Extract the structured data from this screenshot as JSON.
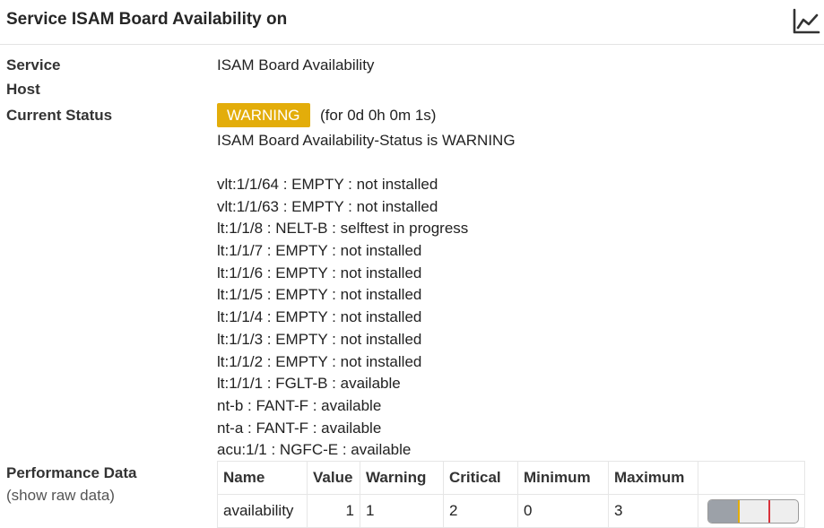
{
  "header": {
    "title": "Service ISAM Board Availability on",
    "chart_icon": "line-chart-icon"
  },
  "details": {
    "service_label": "Service",
    "service_value": "ISAM Board Availability",
    "host_label": "Host",
    "host_value": "",
    "status_label": "Current Status",
    "status_badge": "WARNING",
    "status_badge_color": "#e3ad0a",
    "status_duration": "(for 0d 0h 0m 1s)",
    "status_summary": "ISAM Board Availability-Status is WARNING",
    "output_lines": [
      "vlt:1/1/64 : EMPTY : not installed",
      "vlt:1/1/63 : EMPTY : not installed",
      "lt:1/1/8 : NELT-B : selftest in progress",
      "lt:1/1/7 : EMPTY : not installed",
      "lt:1/1/6 : EMPTY : not installed",
      "lt:1/1/5 : EMPTY : not installed",
      "lt:1/1/4 : EMPTY : not installed",
      "lt:1/1/3 : EMPTY : not installed",
      "lt:1/1/2 : EMPTY : not installed",
      "lt:1/1/1 : FGLT-B : available",
      "nt-b : FANT-F : available",
      "nt-a : FANT-F : available",
      "acu:1/1 : NGFC-E : available"
    ]
  },
  "perfdata": {
    "label": "Performance Data",
    "raw_link": "(show raw data)",
    "columns": [
      "Name",
      "Value",
      "Warning",
      "Critical",
      "Minimum",
      "Maximum"
    ],
    "rows": [
      {
        "name": "availability",
        "value": "1",
        "warning": "1",
        "critical": "2",
        "minimum": "0",
        "maximum": "3",
        "gauge_fraction": 0.333,
        "warn_fraction": 0.333,
        "crit_fraction": 0.667,
        "warn_color": "#e3ad0a",
        "crit_color": "#d9323b"
      }
    ]
  }
}
